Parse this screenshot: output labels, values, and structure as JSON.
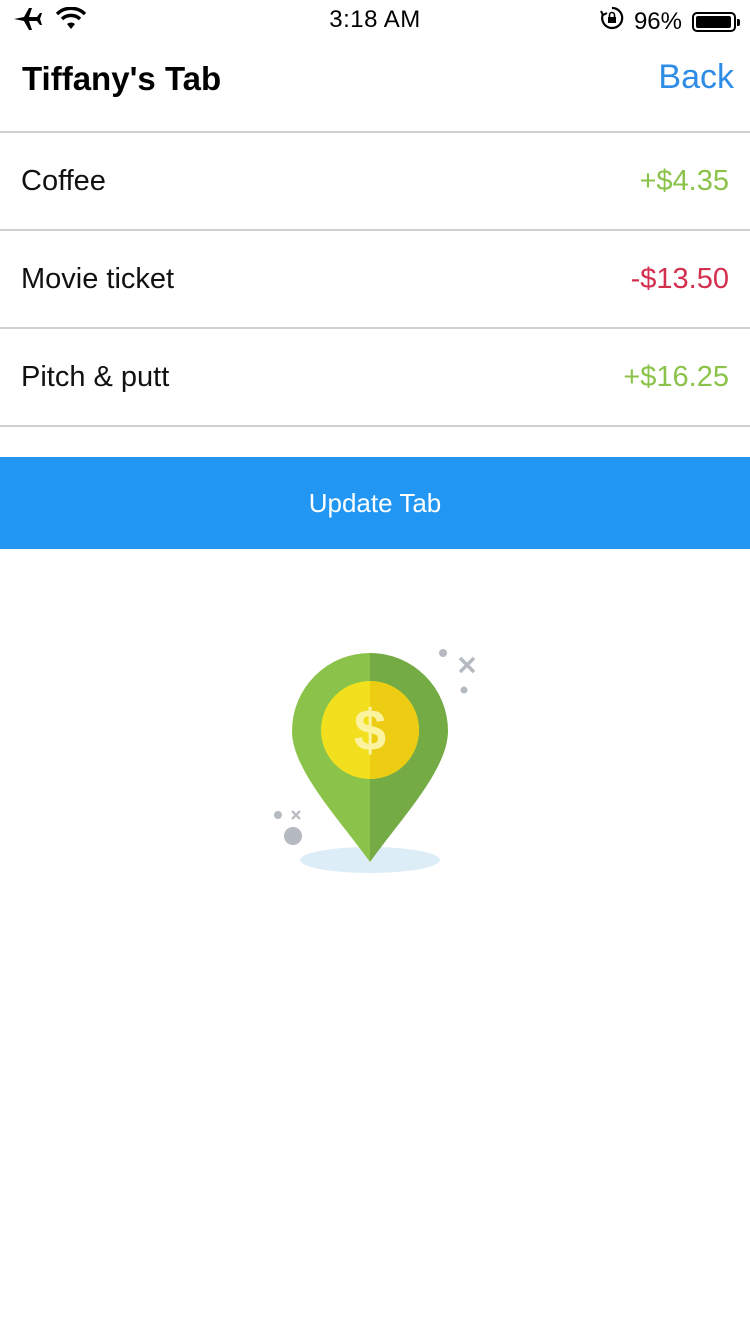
{
  "status_bar": {
    "time": "3:18 AM",
    "battery_percent_label": "96%",
    "battery_level": 0.96,
    "icons": [
      "airplane-icon",
      "wifi-icon",
      "orientation-lock-icon",
      "battery-icon"
    ]
  },
  "header": {
    "title": "Tiffany's Tab",
    "back_label": "Back"
  },
  "items": [
    {
      "label": "Coffee",
      "amount": "+$4.35",
      "type": "positive"
    },
    {
      "label": "Movie ticket",
      "amount": "-$13.50",
      "type": "negative"
    },
    {
      "label": "Pitch & putt",
      "amount": "+$16.25",
      "type": "positive"
    }
  ],
  "update_button": {
    "label": "Update Tab"
  },
  "colors": {
    "accent": "#2196f3",
    "link": "#2d8ce6",
    "positive": "#8bc34a",
    "negative": "#d32f4f",
    "divider": "#d0d0d0"
  },
  "illustration": {
    "icon": "money-location-pin-icon",
    "symbol": "$"
  }
}
